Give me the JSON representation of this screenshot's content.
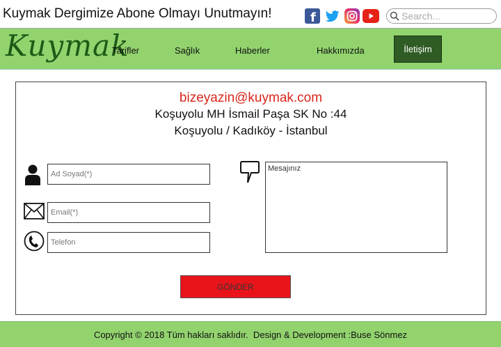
{
  "header": {
    "tagline": "Kuymak Dergimize Abone Olmayı Unutmayın!",
    "social": [
      "facebook-icon",
      "twitter-icon",
      "instagram-icon",
      "youtube-icon"
    ],
    "search_placeholder": "Search..."
  },
  "nav": {
    "logo": "Kuymak",
    "items": [
      "Tarifler",
      "Sağlık",
      "Haberler",
      "Hakkımızda"
    ],
    "active_label": "İletişim",
    "bar_color": "#92d36e",
    "active_color": "#2f5b24"
  },
  "contact": {
    "email": "bizeyazin@kuymak.com",
    "address_line1": "Koşuyolu MH İsmail Paşa SK No :44",
    "address_line2": "Koşuyolu / Kadıköy - İstanbul",
    "name_placeholder": "Ad Soyad(*)",
    "email_placeholder": "Email(*)",
    "phone_placeholder": "Telefon",
    "message_placeholder": "Mesajınız",
    "send_label": "GÖNDER",
    "send_color": "#e8141a"
  },
  "footer": {
    "text": "Copyright © 2018 Tüm hakları saklıdır.  Design & Development :Buse Sönmez"
  }
}
